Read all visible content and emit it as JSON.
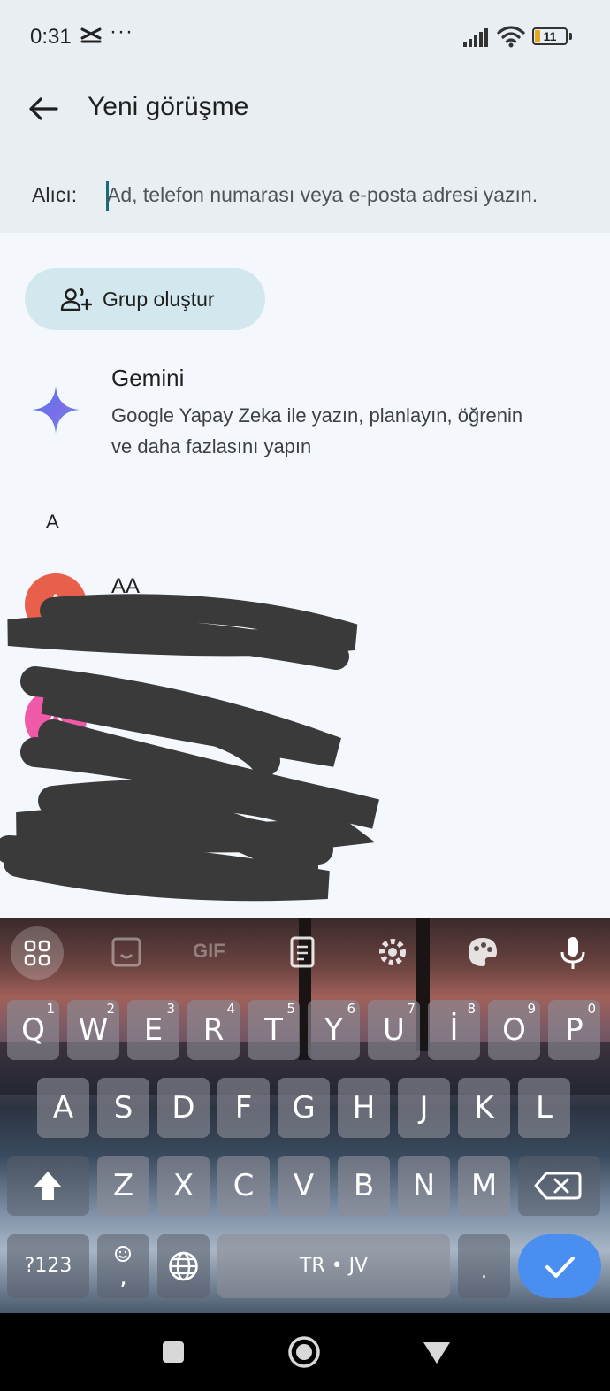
{
  "status_bar": {
    "time": "0:31",
    "app_icon": "capcut-icon",
    "more": "···",
    "battery": "11",
    "battery_color": "#e3a820"
  },
  "header": {
    "back_icon": "arrow-left-icon",
    "title": "Yeni görüşme"
  },
  "recipient": {
    "label": "Alıcı:",
    "placeholder": "Ad, telefon numarası veya e-posta adresi yazın."
  },
  "group_button": {
    "icon": "add-group-icon",
    "label": "Grup oluştur",
    "color": "#d2e8ee"
  },
  "gemini": {
    "icon": "gemini-sparkle-icon",
    "name": "Gemini",
    "description": "Google Yapay Zeka ile yazın, planlayın, öğrenin ve daha fazlasını yapın"
  },
  "contacts": {
    "section_letter": "A",
    "items": [
      {
        "initial": "A",
        "name": "AA",
        "color": "#e8604c"
      },
      {
        "initial": "A",
        "name": "",
        "color": "#ee5aa8"
      },
      {
        "initial": "",
        "name": "",
        "color": "#3aa8d8"
      }
    ]
  },
  "keyboard": {
    "toolbar": [
      "apps-grid-icon",
      "sticker-icon",
      "GIF",
      "clipboard-icon",
      "settings-gear-icon",
      "palette-icon",
      "microphone-icon"
    ],
    "gif_label": "GIF",
    "row1": [
      {
        "key": "Q",
        "hint": "1"
      },
      {
        "key": "W",
        "hint": "2"
      },
      {
        "key": "E",
        "hint": "3"
      },
      {
        "key": "R",
        "hint": "4"
      },
      {
        "key": "T",
        "hint": "5"
      },
      {
        "key": "Y",
        "hint": "6"
      },
      {
        "key": "U",
        "hint": "7"
      },
      {
        "key": "İ",
        "hint": "8"
      },
      {
        "key": "O",
        "hint": "9"
      },
      {
        "key": "P",
        "hint": "0"
      }
    ],
    "row2": [
      "A",
      "S",
      "D",
      "F",
      "G",
      "H",
      "J",
      "K",
      "L"
    ],
    "row3": [
      "Z",
      "X",
      "C",
      "V",
      "B",
      "N",
      "M"
    ],
    "symbols_key": "?123",
    "emoji_comma": ",",
    "space_label": "TR • JV",
    "period_key": ".",
    "enter_color": "#4a8ef0"
  },
  "nav_bar": [
    "recents-square-icon",
    "home-circle-icon",
    "back-triangle-icon"
  ]
}
